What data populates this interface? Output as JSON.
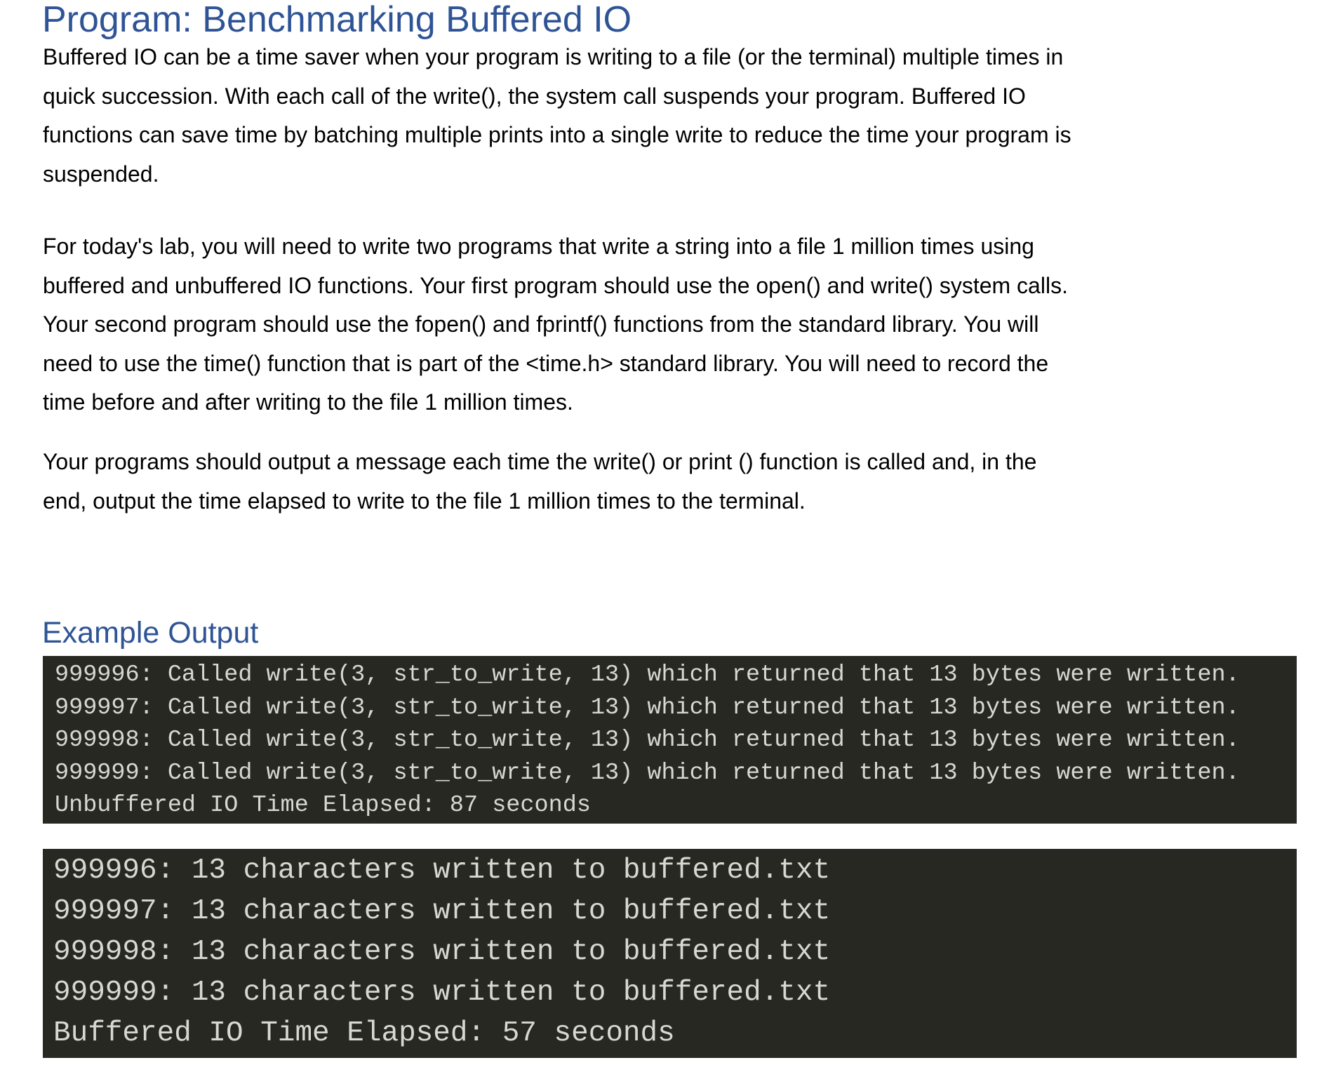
{
  "title": "Program: Benchmarking Buffered IO",
  "paragraphs": [
    [
      "Buffered IO can be a time saver when your program is writing to a file (or the terminal) multiple times in",
      "quick succession. With each call of the write(), the system call suspends your program. Buffered IO",
      "functions can save time by batching multiple prints into a single write to reduce the time your program is",
      "suspended."
    ],
    [
      "For today's lab, you will need to write two programs that write a string into a file 1 million times using",
      "buffered and unbuffered IO functions. Your first program should use the open() and write() system calls.",
      "Your second program should use the fopen() and fprintf() functions from the standard library. You will",
      "need to use the time() function that is part of the <time.h> standard library. You will need to record the",
      "time before and after writing to the file 1 million times."
    ],
    [
      "Your programs should output a message each time the write() or print () function is called and, in the",
      "end, output the time elapsed to write to the file 1 million times to the terminal."
    ]
  ],
  "example_heading": "Example Output",
  "unbuffered_output": [
    "999996: Called write(3, str_to_write, 13) which returned that 13 bytes were written.",
    "999997: Called write(3, str_to_write, 13) which returned that 13 bytes were written.",
    "999998: Called write(3, str_to_write, 13) which returned that 13 bytes were written.",
    "999999: Called write(3, str_to_write, 13) which returned that 13 bytes were written.",
    "Unbuffered IO Time Elapsed: 87 seconds"
  ],
  "buffered_output": [
    "999996: 13 characters written to buffered.txt",
    "999997: 13 characters written to buffered.txt",
    "999998: 13 characters written to buffered.txt",
    "999999: 13 characters written to buffered.txt",
    "Buffered IO Time Elapsed: 57 seconds"
  ],
  "colors": {
    "heading": "#2F5496",
    "terminal_bg": "#272822",
    "terminal_text": "#d8d8d2"
  }
}
